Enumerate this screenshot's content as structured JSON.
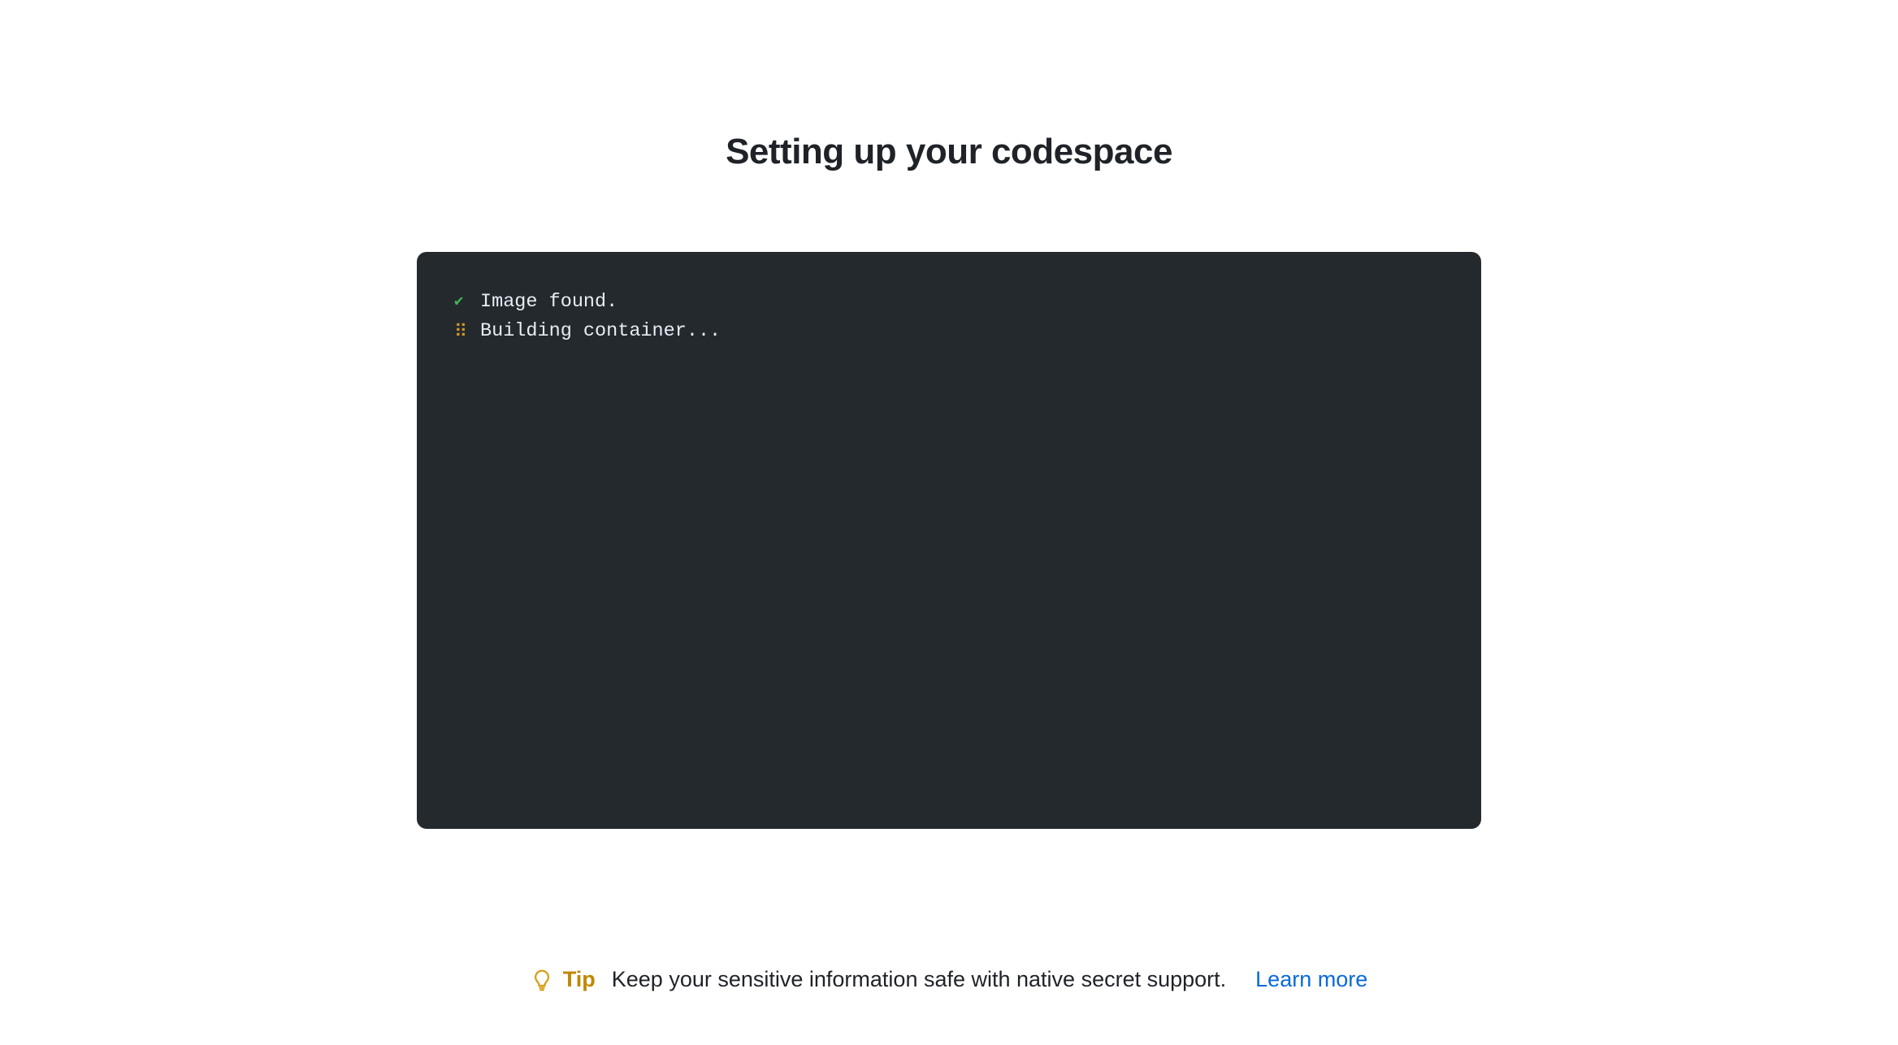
{
  "title": "Setting up your codespace",
  "terminal": {
    "lines": [
      {
        "icon": "check",
        "text": "Image found."
      },
      {
        "icon": "spinner",
        "text": "Building container..."
      }
    ]
  },
  "tip": {
    "label": "Tip",
    "text": "Keep your sensitive information safe with native secret support.",
    "link_label": "Learn more"
  }
}
